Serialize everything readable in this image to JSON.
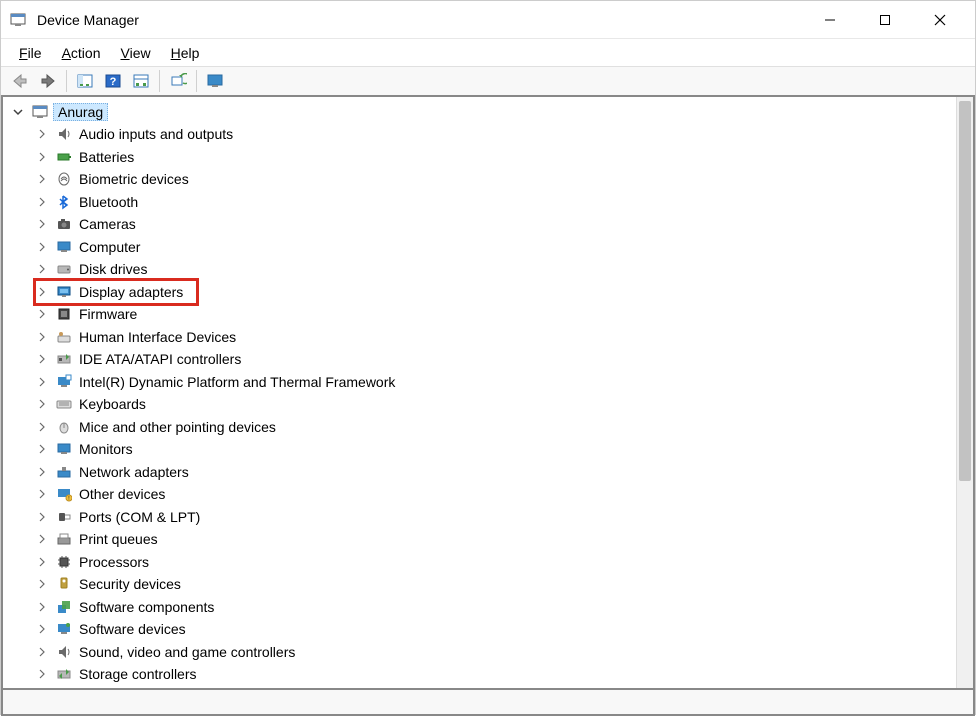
{
  "window": {
    "title": "Device Manager"
  },
  "menu": {
    "file": "File",
    "action": "Action",
    "view": "View",
    "help": "Help"
  },
  "tree": {
    "root": "Anurag",
    "items": [
      {
        "id": "audio",
        "label": "Audio inputs and outputs"
      },
      {
        "id": "batteries",
        "label": "Batteries"
      },
      {
        "id": "biometric",
        "label": "Biometric devices"
      },
      {
        "id": "bluetooth",
        "label": "Bluetooth"
      },
      {
        "id": "cameras",
        "label": "Cameras"
      },
      {
        "id": "computer",
        "label": "Computer"
      },
      {
        "id": "diskdrives",
        "label": "Disk drives"
      },
      {
        "id": "display",
        "label": "Display adapters",
        "highlighted": true
      },
      {
        "id": "firmware",
        "label": "Firmware"
      },
      {
        "id": "hid",
        "label": "Human Interface Devices"
      },
      {
        "id": "ide",
        "label": "IDE ATA/ATAPI controllers"
      },
      {
        "id": "intel-dptf",
        "label": "Intel(R) Dynamic Platform and Thermal Framework"
      },
      {
        "id": "keyboards",
        "label": "Keyboards"
      },
      {
        "id": "mice",
        "label": "Mice and other pointing devices"
      },
      {
        "id": "monitors",
        "label": "Monitors"
      },
      {
        "id": "network",
        "label": "Network adapters"
      },
      {
        "id": "other",
        "label": "Other devices"
      },
      {
        "id": "ports",
        "label": "Ports (COM & LPT)"
      },
      {
        "id": "printqueues",
        "label": "Print queues"
      },
      {
        "id": "processors",
        "label": "Processors"
      },
      {
        "id": "security",
        "label": "Security devices"
      },
      {
        "id": "swcomponents",
        "label": "Software components"
      },
      {
        "id": "swdevices",
        "label": "Software devices"
      },
      {
        "id": "sound",
        "label": "Sound, video and game controllers"
      },
      {
        "id": "storage",
        "label": "Storage controllers"
      }
    ]
  }
}
